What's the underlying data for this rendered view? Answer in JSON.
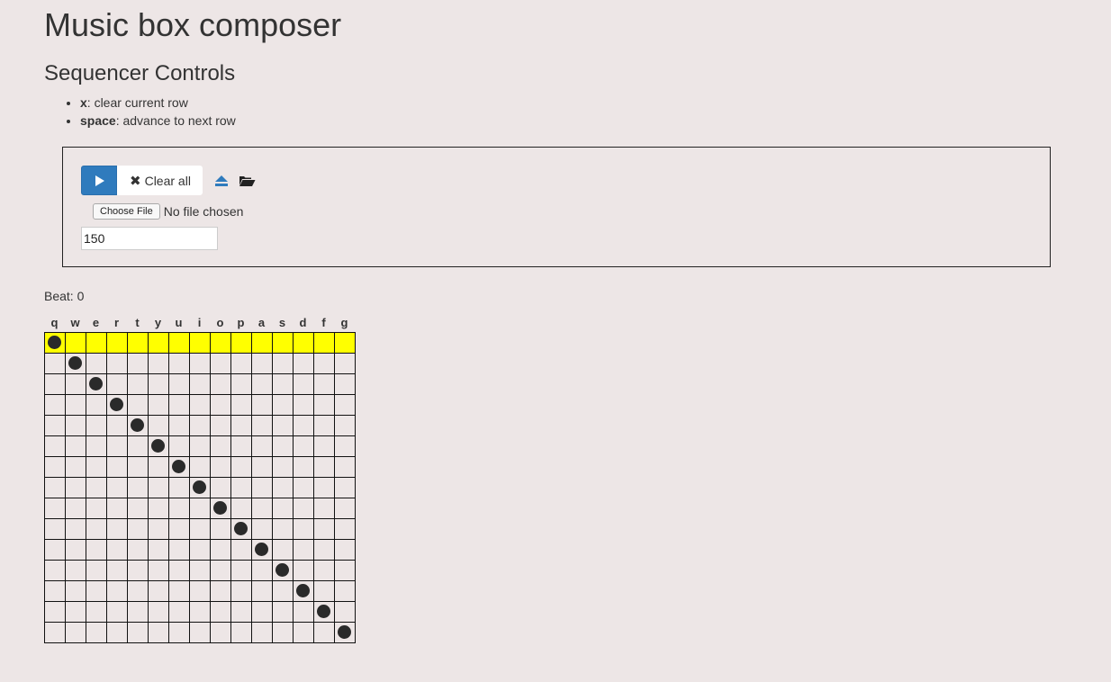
{
  "page": {
    "title": "Music box composer",
    "section_title": "Sequencer Controls",
    "help": [
      {
        "key": "x",
        "text": ": clear current row"
      },
      {
        "key": "space",
        "text": ": advance to next row"
      }
    ]
  },
  "controls": {
    "play_icon": "play-icon",
    "clear_icon": "✖",
    "clear_label": "Clear all",
    "eject_icon": "eject-icon",
    "open_icon": "folder-open-icon",
    "file_button_label": "Choose File",
    "file_status": "No file chosen",
    "tempo_value": "150"
  },
  "beat": {
    "label": "Beat: ",
    "value": "0"
  },
  "grid": {
    "keys": [
      "q",
      "w",
      "e",
      "r",
      "t",
      "y",
      "u",
      "i",
      "o",
      "p",
      "a",
      "s",
      "d",
      "f",
      "g"
    ],
    "rows": 15,
    "current_row": 0,
    "notes": [
      [
        0,
        0
      ],
      [
        1,
        1
      ],
      [
        2,
        2
      ],
      [
        3,
        3
      ],
      [
        4,
        4
      ],
      [
        5,
        5
      ],
      [
        6,
        6
      ],
      [
        7,
        7
      ],
      [
        8,
        8
      ],
      [
        9,
        9
      ],
      [
        10,
        10
      ],
      [
        11,
        11
      ],
      [
        12,
        12
      ],
      [
        13,
        13
      ],
      [
        14,
        14
      ]
    ],
    "highlight_color": "#ffff00",
    "note_color": "#2a2a2a"
  },
  "colors": {
    "background": "#ede6e6",
    "accent": "#2f7bbd"
  }
}
